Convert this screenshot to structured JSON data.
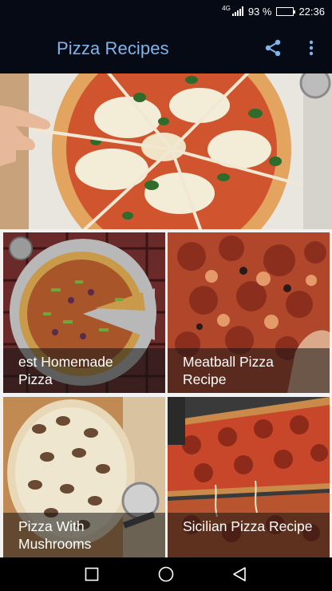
{
  "status_bar": {
    "network": "4G",
    "battery_percent": "93 %",
    "battery_level": 0.93,
    "time": "22:36"
  },
  "app_bar": {
    "title": "Pizza Recipes",
    "share_icon": "share-icon",
    "more_icon": "more-vert-icon"
  },
  "colors": {
    "bar_background": "#050a14",
    "title_accent": "#7fb5ec",
    "battery_green": "#2fd15c"
  },
  "hero": {
    "image": "margherita pizza slices on a wooden board"
  },
  "recipes": [
    {
      "label": "est Homemade Pizza",
      "image": "pizza with peppers on a metal tray"
    },
    {
      "label": "Meatball Pizza Recipe",
      "image": "meatball pizza"
    },
    {
      "label": "Pizza With Mushrooms",
      "image": "mushroom pizza on a board"
    },
    {
      "label": "Sicilian Pizza Recipe",
      "image": "sicilian pepperoni pizza"
    }
  ],
  "nav_bar": {
    "recents_icon": "square-recents-icon",
    "home_icon": "circle-home-icon",
    "back_icon": "triangle-back-icon"
  }
}
